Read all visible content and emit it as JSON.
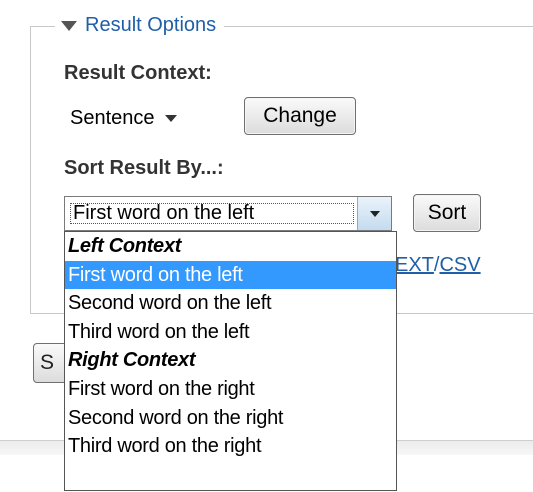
{
  "result_options": {
    "legend": "Result Options",
    "context_label": "Result Context:",
    "context_value": "Sentence",
    "change_button": "Change",
    "sort_label": "Sort Result By...:",
    "sort_value": "First word on the left",
    "sort_button": "Sort",
    "sort_options": [
      {
        "label": "Left Context",
        "group": true
      },
      {
        "label": "First word on the left",
        "selected": true
      },
      {
        "label": "Second word on the left"
      },
      {
        "label": "Third word on the left"
      },
      {
        "label": "Right Context",
        "group": true
      },
      {
        "label": "First word on the right"
      },
      {
        "label": "Second word on the right"
      },
      {
        "label": "Third word on the right"
      }
    ],
    "export_text": "EXT",
    "export_sep": "/",
    "export_csv": "CSV",
    "hidden_button_partial": "S"
  },
  "colors": {
    "link": "#1f5fa8",
    "selection": "#3399ff"
  }
}
